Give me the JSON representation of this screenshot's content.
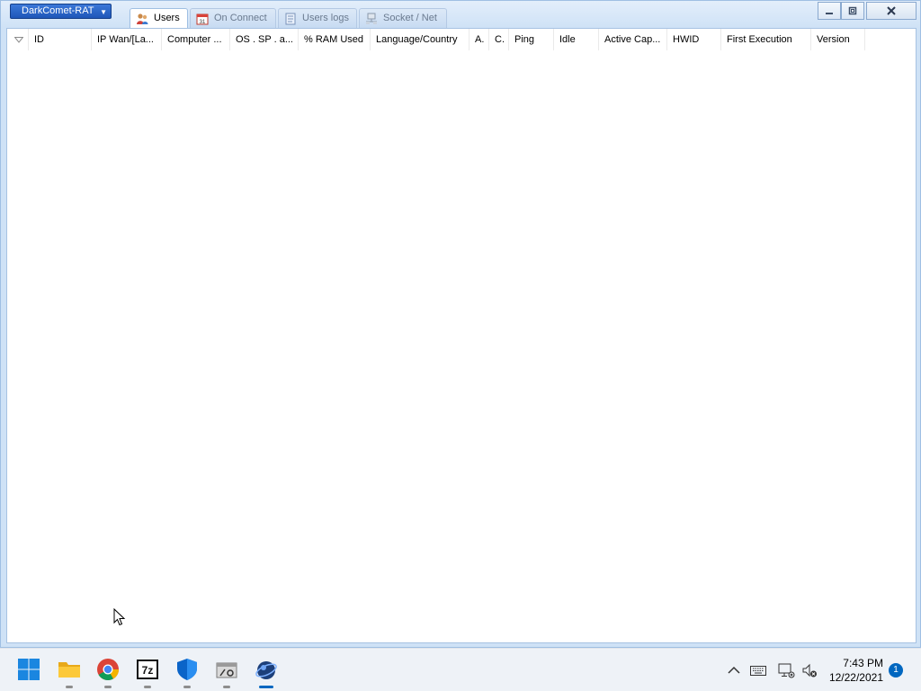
{
  "app": {
    "menu_label": "DarkComet-RAT"
  },
  "tabs": [
    {
      "label": "Users",
      "icon": "users-icon",
      "active": true
    },
    {
      "label": "On Connect",
      "icon": "calendar-icon",
      "active": false
    },
    {
      "label": "Users logs",
      "icon": "log-icon",
      "active": false
    },
    {
      "label": "Socket / Net",
      "icon": "network-icon",
      "active": false
    }
  ],
  "window_controls": {
    "calendar_day": "31"
  },
  "table": {
    "columns": [
      "ID",
      "IP Wan/[La...",
      "Computer ...",
      "OS . SP . a...",
      "% RAM Used",
      "Language/Country",
      "A.",
      "C.",
      "Ping",
      "Idle",
      "Active Cap...",
      "HWID",
      "First Execution",
      "Version"
    ],
    "rows": []
  },
  "taskbar": {
    "apps": [
      {
        "name": "start",
        "icon": "windows-start-icon"
      },
      {
        "name": "file-explorer",
        "icon": "folder-icon"
      },
      {
        "name": "chrome",
        "icon": "chrome-icon"
      },
      {
        "name": "7zip",
        "icon": "7zip-icon",
        "label": "7z"
      },
      {
        "name": "defender",
        "icon": "shield-icon"
      },
      {
        "name": "tool",
        "icon": "tool-icon"
      },
      {
        "name": "darkcomet",
        "icon": "darkcomet-icon"
      }
    ],
    "clock_time": "7:43 PM",
    "clock_date": "12/22/2021",
    "notification_count": "1"
  },
  "colors": {
    "accent": "#0067c0",
    "window_frame": "#cfe2f6",
    "menu_button": "#1e56b8"
  }
}
